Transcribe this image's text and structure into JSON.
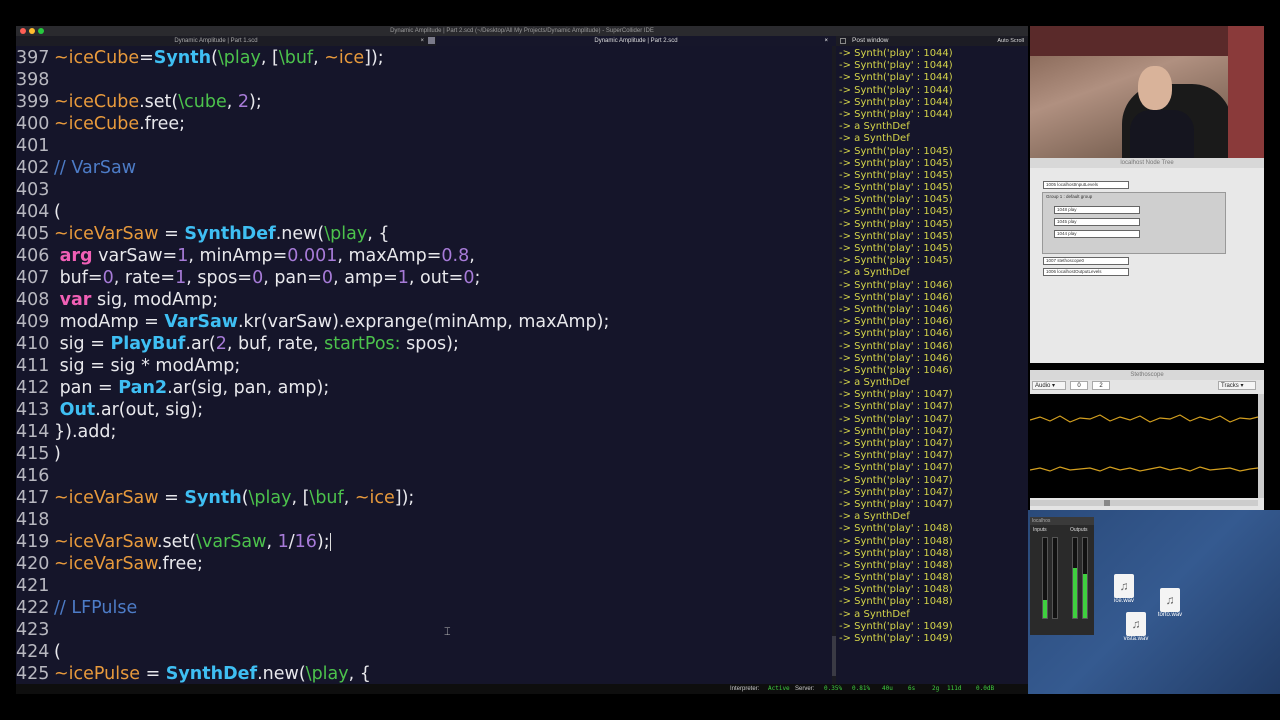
{
  "window": {
    "title": "Dynamic Amplitude | Part 2.scd (~/Desktop/All My Projects/Dynamic Amplitude) - SuperCollider IDE"
  },
  "tabs": [
    {
      "label": "Dynamic Amplitude | Part 1.scd"
    },
    {
      "label": "Dynamic Amplitude | Part 2.scd"
    }
  ],
  "post_window": {
    "title": "Post window",
    "auto_scroll_label": "Auto Scroll",
    "lines": [
      "-> Synth('play' : 1044)",
      "-> Synth('play' : 1044)",
      "-> Synth('play' : 1044)",
      "-> Synth('play' : 1044)",
      "-> Synth('play' : 1044)",
      "-> Synth('play' : 1044)",
      "-> a SynthDef",
      "-> a SynthDef",
      "-> Synth('play' : 1045)",
      "-> Synth('play' : 1045)",
      "-> Synth('play' : 1045)",
      "-> Synth('play' : 1045)",
      "-> Synth('play' : 1045)",
      "-> Synth('play' : 1045)",
      "-> Synth('play' : 1045)",
      "-> Synth('play' : 1045)",
      "-> Synth('play' : 1045)",
      "-> Synth('play' : 1045)",
      "-> a SynthDef",
      "-> Synth('play' : 1046)",
      "-> Synth('play' : 1046)",
      "-> Synth('play' : 1046)",
      "-> Synth('play' : 1046)",
      "-> Synth('play' : 1046)",
      "-> Synth('play' : 1046)",
      "-> Synth('play' : 1046)",
      "-> Synth('play' : 1046)",
      "-> a SynthDef",
      "-> Synth('play' : 1047)",
      "-> Synth('play' : 1047)",
      "-> Synth('play' : 1047)",
      "-> Synth('play' : 1047)",
      "-> Synth('play' : 1047)",
      "-> Synth('play' : 1047)",
      "-> Synth('play' : 1047)",
      "-> Synth('play' : 1047)",
      "-> Synth('play' : 1047)",
      "-> Synth('play' : 1047)",
      "-> a SynthDef",
      "-> Synth('play' : 1048)",
      "-> Synth('play' : 1048)",
      "-> Synth('play' : 1048)",
      "-> Synth('play' : 1048)",
      "-> Synth('play' : 1048)",
      "-> Synth('play' : 1048)",
      "-> Synth('play' : 1048)",
      "-> a SynthDef",
      "-> Synth('play' : 1049)",
      "-> Synth('play' : 1049)"
    ]
  },
  "code_lines": [
    {
      "n": "397",
      "tokens": [
        [
          "env",
          "~iceCube"
        ],
        [
          "",
          "="
        ],
        [
          "cls",
          "Synth"
        ],
        [
          "",
          "("
        ],
        [
          "sym",
          "\\play"
        ],
        [
          "",
          ", ["
        ],
        [
          "sym",
          "\\buf"
        ],
        [
          "",
          ", "
        ],
        [
          "env",
          "~ice"
        ],
        [
          "",
          "]);"
        ]
      ]
    },
    {
      "n": "398",
      "tokens": []
    },
    {
      "n": "399",
      "tokens": [
        [
          "env",
          "~iceCube"
        ],
        [
          "",
          ".set("
        ],
        [
          "sym",
          "\\cube"
        ],
        [
          "",
          ", "
        ],
        [
          "num",
          "2"
        ],
        [
          "",
          ");"
        ]
      ]
    },
    {
      "n": "400",
      "tokens": [
        [
          "env",
          "~iceCube"
        ],
        [
          "",
          ".free;"
        ]
      ]
    },
    {
      "n": "401",
      "tokens": []
    },
    {
      "n": "402",
      "tokens": [
        [
          "cmt",
          "// VarSaw"
        ]
      ]
    },
    {
      "n": "403",
      "tokens": []
    },
    {
      "n": "404",
      "tokens": [
        [
          "",
          "("
        ]
      ]
    },
    {
      "n": "405",
      "tokens": [
        [
          "env",
          "~iceVarSaw"
        ],
        [
          "",
          " = "
        ],
        [
          "cls",
          "SynthDef"
        ],
        [
          "",
          ".new("
        ],
        [
          "sym",
          "\\play"
        ],
        [
          "",
          ", {"
        ]
      ]
    },
    {
      "n": "406",
      "tokens": [
        [
          "",
          " "
        ],
        [
          "kw",
          "arg"
        ],
        [
          "",
          " varSaw="
        ],
        [
          "num",
          "1"
        ],
        [
          "",
          ", minAmp="
        ],
        [
          "num",
          "0.001"
        ],
        [
          "",
          ", maxAmp="
        ],
        [
          "num",
          "0.8"
        ],
        [
          "",
          ","
        ]
      ]
    },
    {
      "n": "407",
      "tokens": [
        [
          "",
          " buf="
        ],
        [
          "num",
          "0"
        ],
        [
          "",
          ", rate="
        ],
        [
          "num",
          "1"
        ],
        [
          "",
          ", spos="
        ],
        [
          "num",
          "0"
        ],
        [
          "",
          ", pan="
        ],
        [
          "num",
          "0"
        ],
        [
          "",
          ", amp="
        ],
        [
          "num",
          "1"
        ],
        [
          "",
          ", out="
        ],
        [
          "num",
          "0"
        ],
        [
          "",
          ";"
        ]
      ]
    },
    {
      "n": "408",
      "tokens": [
        [
          "",
          " "
        ],
        [
          "kw",
          "var"
        ],
        [
          "",
          " sig, modAmp;"
        ]
      ]
    },
    {
      "n": "409",
      "tokens": [
        [
          "",
          " modAmp = "
        ],
        [
          "cls",
          "VarSaw"
        ],
        [
          "",
          ".kr(varSaw).exprange(minAmp, maxAmp);"
        ]
      ]
    },
    {
      "n": "410",
      "tokens": [
        [
          "",
          " sig = "
        ],
        [
          "cls",
          "PlayBuf"
        ],
        [
          "",
          ".ar("
        ],
        [
          "num",
          "2"
        ],
        [
          "",
          ", buf, rate, "
        ],
        [
          "sym",
          "startPos:"
        ],
        [
          "",
          " spos);"
        ]
      ]
    },
    {
      "n": "411",
      "tokens": [
        [
          "",
          " sig = sig * modAmp;"
        ]
      ]
    },
    {
      "n": "412",
      "tokens": [
        [
          "",
          " pan = "
        ],
        [
          "cls",
          "Pan2"
        ],
        [
          "",
          ".ar(sig, pan, amp);"
        ]
      ]
    },
    {
      "n": "413",
      "tokens": [
        [
          "",
          " "
        ],
        [
          "cls",
          "Out"
        ],
        [
          "",
          ".ar(out, sig);"
        ]
      ]
    },
    {
      "n": "414",
      "tokens": [
        [
          "",
          "}).add;"
        ]
      ]
    },
    {
      "n": "415",
      "tokens": [
        [
          "",
          ")"
        ]
      ]
    },
    {
      "n": "416",
      "tokens": []
    },
    {
      "n": "417",
      "tokens": [
        [
          "env",
          "~iceVarSaw"
        ],
        [
          "",
          " = "
        ],
        [
          "cls",
          "Synth"
        ],
        [
          "",
          "("
        ],
        [
          "sym",
          "\\play"
        ],
        [
          "",
          ", ["
        ],
        [
          "sym",
          "\\buf"
        ],
        [
          "",
          ", "
        ],
        [
          "env",
          "~ice"
        ],
        [
          "",
          "]);"
        ]
      ]
    },
    {
      "n": "418",
      "tokens": []
    },
    {
      "n": "419",
      "tokens": [
        [
          "env",
          "~iceVarSaw"
        ],
        [
          "",
          ".set("
        ],
        [
          "sym",
          "\\varSaw"
        ],
        [
          "",
          ", "
        ],
        [
          "num",
          "1"
        ],
        [
          "",
          "/"
        ],
        [
          "num",
          "16"
        ],
        [
          "",
          ");"
        ]
      ]
    },
    {
      "n": "420",
      "tokens": [
        [
          "env",
          "~iceVarSaw"
        ],
        [
          "",
          ".free;"
        ]
      ]
    },
    {
      "n": "421",
      "tokens": []
    },
    {
      "n": "422",
      "tokens": [
        [
          "cmt",
          "// LFPulse"
        ]
      ]
    },
    {
      "n": "423",
      "tokens": []
    },
    {
      "n": "424",
      "tokens": [
        [
          "",
          "("
        ]
      ]
    },
    {
      "n": "425",
      "tokens": [
        [
          "env",
          "~icePulse"
        ],
        [
          "",
          " = "
        ],
        [
          "cls",
          "SynthDef"
        ],
        [
          "",
          ".new("
        ],
        [
          "sym",
          "\\play"
        ],
        [
          "",
          ", {"
        ]
      ]
    }
  ],
  "status": {
    "interpreter_label": "Interpreter:",
    "interpreter_state": "Active",
    "server_label": "Server:",
    "values": [
      "0.35%",
      "0.81%",
      "40u",
      "6s",
      "2g",
      "111d",
      "0.0dB"
    ]
  },
  "node_tree": {
    "title": "localhost Node Tree",
    "items": [
      "1005 localhostInputLevels",
      "Group 1 : default group",
      "1048 play",
      "1045 play",
      "1044 play",
      "1007 stethoscope0",
      "1006 localhostOutputLevels"
    ]
  },
  "stethoscope": {
    "title": "Stethoscope",
    "mode": "Audio",
    "index": "0",
    "channels": "2",
    "view": "Tracks"
  },
  "meter": {
    "title": "localhos",
    "inputs_label": "Inputs",
    "outputs_label": "Outputs",
    "input_levels": [
      0.22,
      0.0
    ],
    "output_levels": [
      0.62,
      0.55
    ]
  },
  "desktop_files": [
    {
      "name": "ice.wav"
    },
    {
      "name": "torto.wav"
    },
    {
      "name": "vista.wav"
    }
  ],
  "colors": {
    "editor_bg": "#15152a",
    "env_var": "#e89a3c",
    "class": "#3fbff3",
    "symbol": "#4cc24c",
    "number": "#a77bd8",
    "keyword": "#f05fb5",
    "comment": "#4d7cc7",
    "post_text": "#d4d44a"
  }
}
